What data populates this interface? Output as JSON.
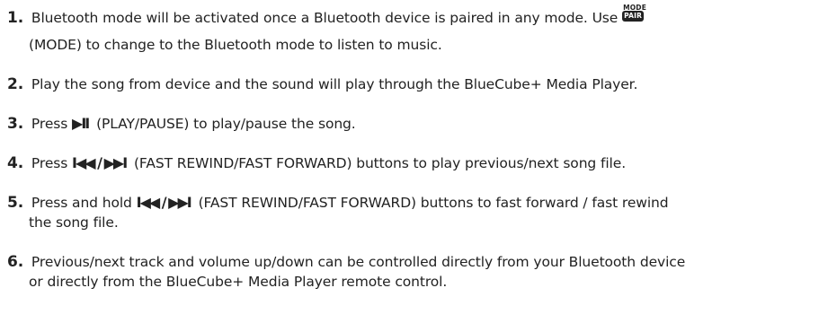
{
  "steps": [
    {
      "num": "1.",
      "text_a": "Bluetooth mode will be activated once a Bluetooth device is paired in any mode. Use",
      "mode_caption": "MODE",
      "pair_badge": "PAIR",
      "text_b": "(MODE) to change to the Bluetooth mode to listen to music."
    },
    {
      "num": "2.",
      "text": "Play the song from device and the sound will play through the BlueCube+ Media Player."
    },
    {
      "num": "3.",
      "text_pre": "Press",
      "icon": "▶II",
      "text": "(PLAY/PAUSE) to play/pause the song."
    },
    {
      "num": "4.",
      "text_pre": "Press",
      "icon": "I◀◀ / ▶▶I",
      "text": "(FAST REWIND/FAST FORWARD) buttons to play previous/next song file."
    },
    {
      "num": "5.",
      "text_pre": "Press and hold",
      "icon": "I◀◀ / ▶▶I",
      "text": "(FAST REWIND/FAST FORWARD) buttons to fast forward / fast rewind",
      "text_cont": "the song file."
    },
    {
      "num": "6.",
      "text": "Previous/next track and volume up/down can be controlled directly from your Bluetooth device",
      "text_cont": "or directly from the BlueCube+ Media Player remote control."
    }
  ],
  "icons": {
    "pair": "pair-mode-button-icon",
    "play_pause": "play-pause-icon",
    "rewind_forward": "rewind-forward-icon"
  }
}
